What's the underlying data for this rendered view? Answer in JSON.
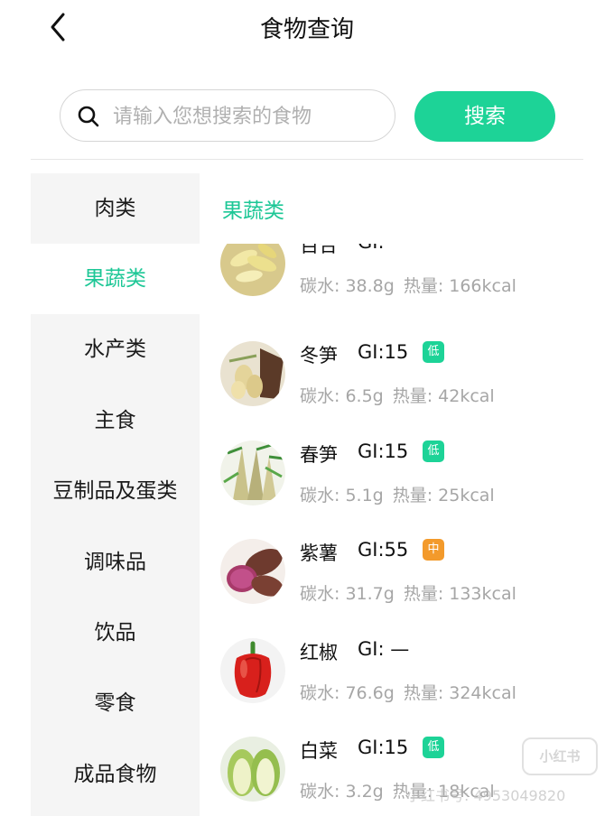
{
  "header": {
    "title": "食物查询",
    "back_icon": "chevron-left-icon"
  },
  "search": {
    "placeholder": "请输入您想搜索的食物",
    "value": "",
    "button_label": "搜索",
    "icon": "search-icon"
  },
  "sidebar": {
    "items": [
      {
        "label": "肉类",
        "active": false
      },
      {
        "label": "果蔬类",
        "active": true
      },
      {
        "label": "水产类",
        "active": false
      },
      {
        "label": "主食",
        "active": false
      },
      {
        "label": "豆制品及蛋类",
        "active": false
      },
      {
        "label": "调味品",
        "active": false
      },
      {
        "label": "饮品",
        "active": false
      },
      {
        "label": "零食",
        "active": false
      },
      {
        "label": "成品食物",
        "active": false
      }
    ]
  },
  "content": {
    "section_title": "果蔬类",
    "foods": [
      {
        "name": "百合",
        "gi": "GI: —",
        "badge": "",
        "carbs": "碳水: 38.8g",
        "calories": "热量: 166kcal"
      },
      {
        "name": "冬笋",
        "gi": "GI:15",
        "badge": "低",
        "carbs": "碳水: 6.5g",
        "calories": "热量: 42kcal"
      },
      {
        "name": "春笋",
        "gi": "GI:15",
        "badge": "低",
        "carbs": "碳水: 5.1g",
        "calories": "热量: 25kcal"
      },
      {
        "name": "紫薯",
        "gi": "GI:55",
        "badge": "中",
        "carbs": "碳水: 31.7g",
        "calories": "热量: 133kcal"
      },
      {
        "name": "红椒",
        "gi": "GI: —",
        "badge": "",
        "carbs": "碳水: 76.6g",
        "calories": "热量: 324kcal"
      },
      {
        "name": "白菜",
        "gi": "GI:15",
        "badge": "低",
        "carbs": "碳水: 3.2g",
        "calories": "热量: 18kcal"
      }
    ]
  },
  "badge_colors": {
    "低": "#1dd397",
    "中": "#f39a2b"
  },
  "colors": {
    "accent": "#1dc796",
    "button": "#1dd397",
    "sidebar_bg": "#f5f5f5",
    "secondary_text": "#a6a6a6"
  },
  "watermark": {
    "logo": "小红书",
    "id": "小红书号: 4953049820"
  }
}
